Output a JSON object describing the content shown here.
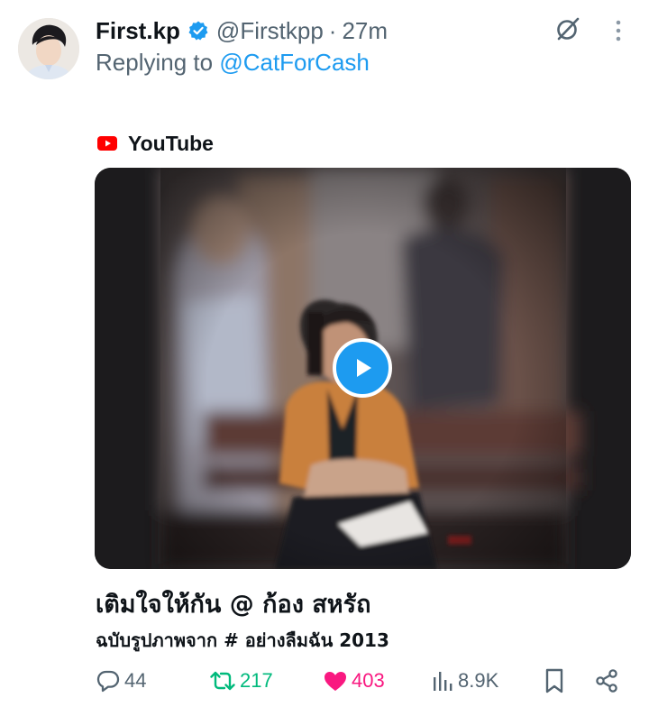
{
  "tweet": {
    "display_name": "First.kp",
    "handle": "@Firstkpp",
    "separator": "·",
    "time": "27m",
    "replying_prefix": "Replying to ",
    "replying_to": "@CatForCash",
    "verified_icon": "verified-badge-icon",
    "colors": {
      "accent": "#1d9bf0",
      "retweet": "#00ba7c",
      "like": "#f91880",
      "muted": "#536471"
    }
  },
  "card": {
    "source": "YouTube",
    "title": "เติมใจให้กัน @ ก้อง สหรัถ",
    "description": "ฉบับรูปภาพจาก # อย่างลืมฉัน 2013",
    "play_icon": "play-icon"
  },
  "actions": {
    "reply_count": "44",
    "retweet_count": "217",
    "like_count": "403",
    "views_count": "8.9K",
    "liked": true,
    "retweeted": true
  }
}
